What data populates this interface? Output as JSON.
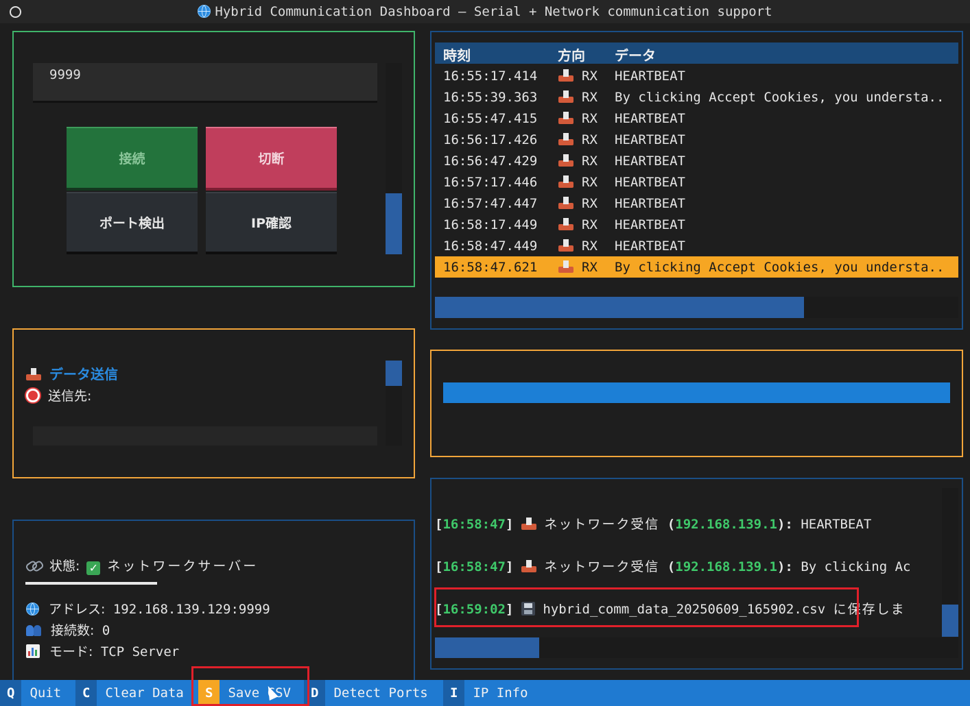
{
  "window": {
    "title": "Hybrid Communication Dashboard — Serial + Network communication support"
  },
  "connect_panel": {
    "port_value": "9999",
    "buttons": {
      "connect": "接続",
      "disconnect": "切断",
      "detect_ports": "ポート検出",
      "ip_check": "IP確認"
    }
  },
  "send_panel": {
    "title": "データ送信",
    "target_label": "送信先:"
  },
  "status_panel": {
    "state_label": "状態:",
    "state_value": "ネットワークサーバー",
    "address_label": "アドレス:",
    "address_value": "192.168.139.129:9999",
    "connections_label": "接続数:",
    "connections_value": "0",
    "mode_label": "モード:",
    "mode_value": "TCP Server"
  },
  "log_table": {
    "headers": [
      "時刻",
      "方向",
      "データ"
    ],
    "rows": [
      {
        "time": "16:55:17.414",
        "dir": "RX",
        "data": "HEARTBEAT"
      },
      {
        "time": "16:55:39.363",
        "dir": "RX",
        "data": "By clicking Accept Cookies, you understa.."
      },
      {
        "time": "16:55:47.415",
        "dir": "RX",
        "data": "HEARTBEAT"
      },
      {
        "time": "16:56:17.426",
        "dir": "RX",
        "data": "HEARTBEAT"
      },
      {
        "time": "16:56:47.429",
        "dir": "RX",
        "data": "HEARTBEAT"
      },
      {
        "time": "16:57:17.446",
        "dir": "RX",
        "data": "HEARTBEAT"
      },
      {
        "time": "16:57:47.447",
        "dir": "RX",
        "data": "HEARTBEAT"
      },
      {
        "time": "16:58:17.449",
        "dir": "RX",
        "data": "HEARTBEAT"
      },
      {
        "time": "16:58:47.449",
        "dir": "RX",
        "data": "HEARTBEAT"
      },
      {
        "time": "16:58:47.621",
        "dir": "RX",
        "data": "By clicking Accept Cookies, you understa.."
      }
    ],
    "selected_index": 9
  },
  "messages": [
    {
      "ts": "16:58:47",
      "label": "ネットワーク受信",
      "ip": "192.168.139.1",
      "text": "HEARTBEAT"
    },
    {
      "ts": "16:58:47",
      "label": "ネットワーク受信",
      "ip": "192.168.139.1",
      "text": "By clicking Ac"
    },
    {
      "ts": "16:59:02",
      "file": "hybrid_comm_data_20250609_165902.csv",
      "suffix": "に保存しま"
    }
  ],
  "footer": {
    "keys": [
      {
        "key": "Q",
        "label": "Quit"
      },
      {
        "key": "C",
        "label": "Clear Data"
      },
      {
        "key": "S",
        "label": "Save CSV"
      },
      {
        "key": "D",
        "label": "Detect Ports"
      },
      {
        "key": "I",
        "label": "IP Info"
      }
    ],
    "active_key": "S"
  },
  "colors": {
    "accent_blue": "#1f7ad1",
    "highlight_orange": "#f6a623",
    "connect_green": "#23733c",
    "disconnect_red": "#c03e5c",
    "annotation_red": "#e0202a"
  }
}
